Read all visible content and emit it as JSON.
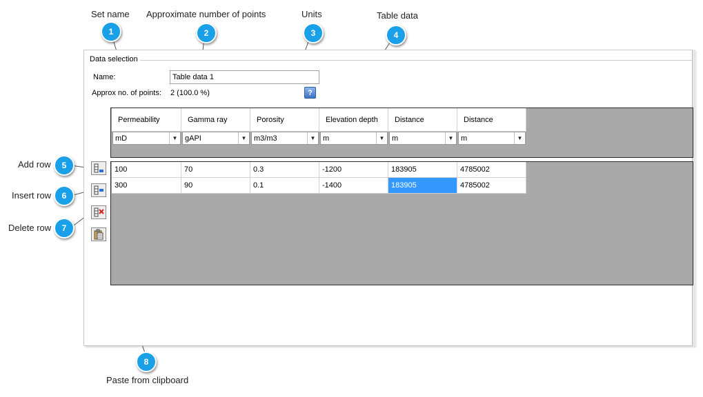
{
  "callouts": {
    "set_name": "Set name",
    "approx_points": "Approximate number of points",
    "units": "Units",
    "table_data": "Table data",
    "add_row": "Add row",
    "insert_row": "Insert row",
    "delete_row": "Delete row",
    "paste": "Paste from clipboard"
  },
  "badges": [
    "1",
    "2",
    "3",
    "4",
    "5",
    "6",
    "7",
    "8"
  ],
  "form": {
    "group_title": "Data selection",
    "name_label": "Name:",
    "name_value": "Table data 1",
    "approx_label": "Approx no. of points:",
    "approx_value": "2 (100.0 %)",
    "help_label": "?"
  },
  "table": {
    "headers": [
      "Permeability",
      "Gamma ray",
      "Porosity",
      "Elevation depth",
      "Distance",
      "Distance"
    ],
    "units": [
      "mD",
      "gAPI",
      "m3/m3",
      "m",
      "m",
      "m"
    ],
    "rows": [
      [
        "100",
        "70",
        "0.3",
        "-1200",
        "183905",
        "4785002"
      ],
      [
        "300",
        "90",
        "0.1",
        "-1400",
        "183905",
        "4785002"
      ]
    ],
    "selected_cell": [
      1,
      4
    ]
  },
  "colors": {
    "badge": "#1aa0e8",
    "grid_background": "#a9a9a9",
    "selection": "#3399ff"
  },
  "icons": [
    "add-row-icon",
    "insert-row-icon",
    "delete-row-icon",
    "paste-icon",
    "help-icon",
    "dropdown-arrow-icon"
  ]
}
